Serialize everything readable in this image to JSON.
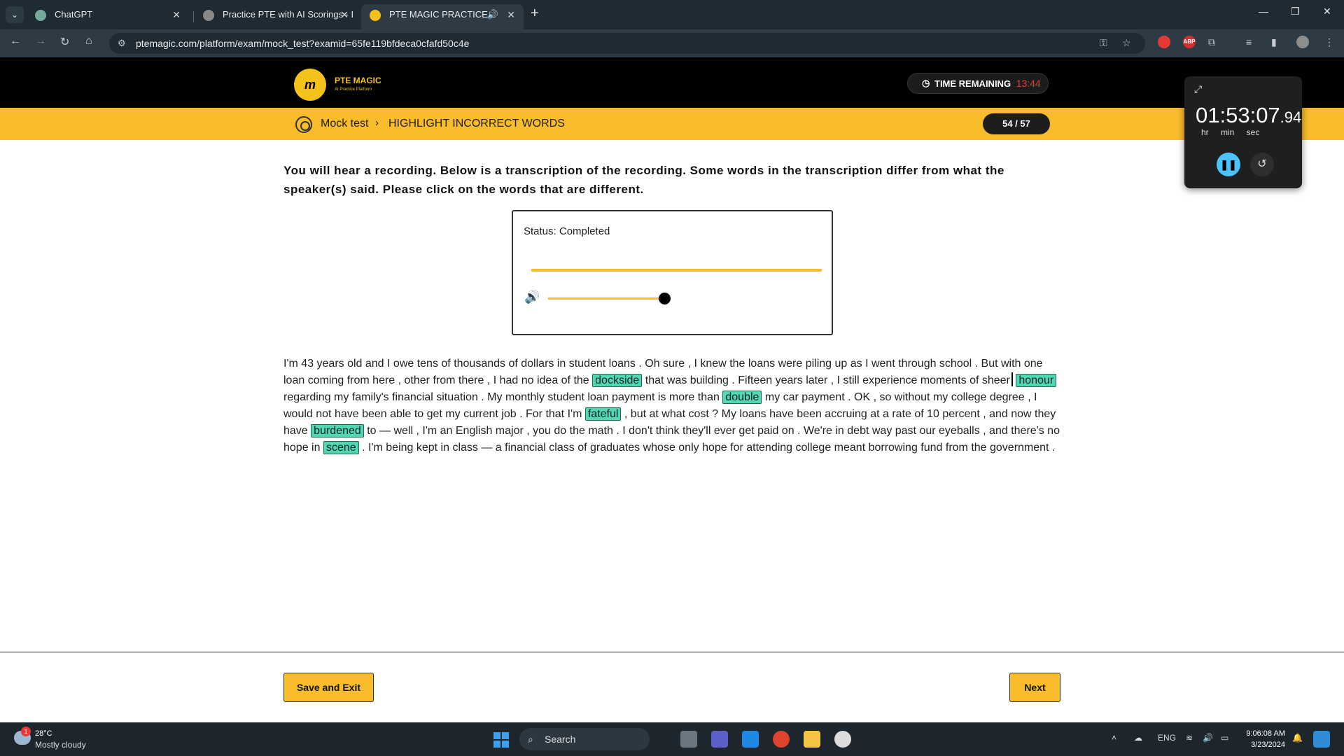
{
  "browser": {
    "tabs": [
      {
        "title": "ChatGPT",
        "active": false
      },
      {
        "title": "Practice PTE with AI Scorings - I",
        "active": false
      },
      {
        "title": "PTE MAGIC PRACTICE",
        "active": true
      }
    ],
    "url": "ptemagic.com/platform/exam/mock_test?examid=65fe119bfdeca0cfafd50c4e",
    "extensions": [
      "ABP"
    ]
  },
  "header": {
    "logo_mark": "m",
    "logo_title": "PTE MAGIC",
    "logo_subtitle": "AI Practice Platform",
    "timer_label": "TIME REMAINING",
    "timer_value": "13:44"
  },
  "breadcrumb": {
    "root": "Mock test",
    "current": "HIGHLIGHT INCORRECT WORDS",
    "progress": "54 / 57"
  },
  "instructions": "You will hear a recording. Below is a transcription of the recording. Some words in the transcription differ from what the speaker(s) said. Please click on the words that are different.",
  "player": {
    "status": "Status: Completed",
    "playback_progress": 1.0,
    "volume": 1.0
  },
  "transcript": {
    "t1": "I'm 43 years old and I owe tens of thousands of dollars in student loans . Oh sure , I knew the loans were piling up as I went through school . But with one loan coming from here , other from there , I had no idea of the",
    "h1": "dockside",
    "t2": "that was building . Fifteen years later , I still experience moments of sheer",
    "h2": "honour",
    "t3": "regarding my family's financial situation . My monthly student loan payment is more than",
    "h3": "double",
    "t4": "my car payment . OK , so without my college degree , I would not have been able to get my current job . For that I'm",
    "h4": "fateful",
    "t5": ", but at what cost ? My loans have been accruing at a rate of 10 percent , and now they have",
    "h5": "burdened",
    "t6": "to — well , I'm an English major , you do the math . I don't think they'll ever get paid on . We're in debt way past our eyeballs , and there's no hope in",
    "h6": "scene",
    "t7": ". I'm being kept in class — a financial class of graduates whose only hope for attending college meant borrowing fund from the government ."
  },
  "buttons": {
    "save_exit": "Save and Exit",
    "next": "Next"
  },
  "stopwatch": {
    "time": "01:53:07",
    "ms": ".94",
    "units": "hr min sec"
  },
  "taskbar": {
    "weather_badge": "1",
    "temperature": "28°C",
    "condition": "Mostly cloudy",
    "search_placeholder": "Search",
    "language": "ENG",
    "time": "9:06:08 AM",
    "date": "3/23/2024"
  },
  "colors": {
    "accent": "#f9bd2b",
    "highlight": "#4fd8b4",
    "timer_red": "#f0353a"
  }
}
